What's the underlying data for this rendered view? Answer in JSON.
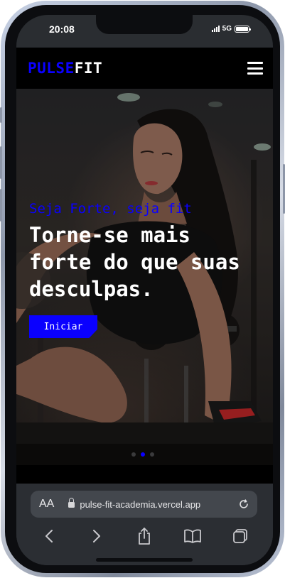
{
  "status_bar": {
    "time": "20:08",
    "network": "5G"
  },
  "site": {
    "logo_part1": "PULSE",
    "logo_part2": "FIT",
    "hero": {
      "tagline": "Seja Forte, seja fit",
      "heading": "Torne-se mais forte do que suas desculpas.",
      "cta_label": "Iniciar",
      "carousel_total": 3,
      "carousel_active": 2
    }
  },
  "browser": {
    "text_size_label": "AA",
    "url": "pulse-fit-academia.vercel.app"
  },
  "colors": {
    "brand_blue": "#0a00ff",
    "header_bg": "#000000",
    "safari_bar": "#2b2e33"
  },
  "icons": {
    "menu": "hamburger-menu-icon",
    "lock": "lock-icon",
    "reload": "reload-icon",
    "back": "chevron-left-icon",
    "forward": "chevron-right-icon",
    "share": "share-icon",
    "bookmarks": "book-icon",
    "tabs": "tabs-icon"
  }
}
